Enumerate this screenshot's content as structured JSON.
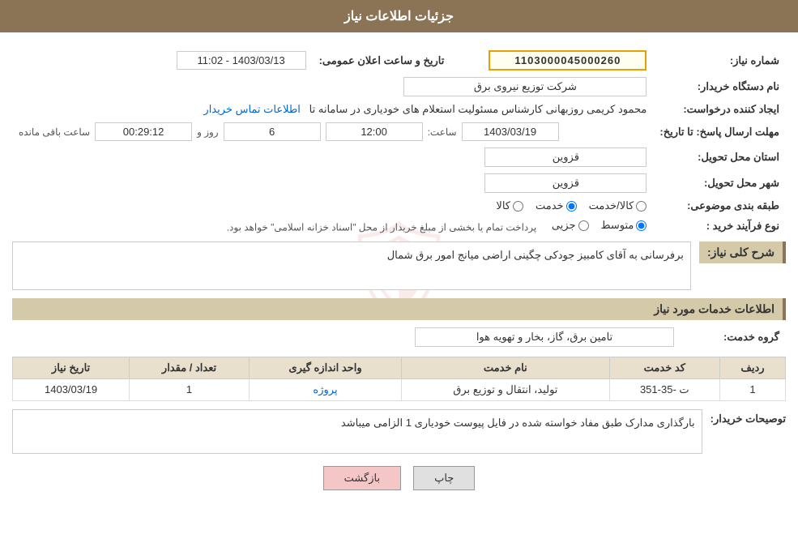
{
  "header": {
    "title": "جزئیات اطلاعات نیاز"
  },
  "form": {
    "need_number_label": "شماره نیاز:",
    "need_number_value": "1103000045000260",
    "buyer_org_label": "نام دستگاه خریدار:",
    "buyer_org_value": "شرکت توزیع نیروی برق",
    "creator_label": "ایجاد کننده درخواست:",
    "creator_name": "محمود کریمی روزبهانی کارشناس  مسئولیت استعلام های خودیاری در سامانه تا",
    "creator_contact_link": "اطلاعات تماس خریدار",
    "send_deadline_label": "مهلت ارسال پاسخ: تا تاریخ:",
    "send_date_value": "1403/03/19",
    "send_time_label": "ساعت:",
    "send_time_value": "12:00",
    "send_days_label": "روز و",
    "send_days_value": "6",
    "send_remaining_label": "ساعت باقی مانده",
    "send_remaining_value": "00:29:12",
    "announce_label": "تاریخ و ساعت اعلان عمومی:",
    "announce_value": "1403/03/13 - 11:02",
    "province_label": "استان محل تحویل:",
    "province_value": "قزوین",
    "city_label": "شهر محل تحویل:",
    "city_value": "قزوین",
    "category_label": "طبقه بندی موضوعی:",
    "category_options": [
      {
        "label": "کالا",
        "value": "kala"
      },
      {
        "label": "خدمت",
        "value": "khedmat"
      },
      {
        "label": "کالا/خدمت",
        "value": "kala_khedmat"
      }
    ],
    "category_selected": "khedmat",
    "purchase_type_label": "نوع فرآیند خرید :",
    "purchase_type_options": [
      {
        "label": "جزیی",
        "value": "jozi"
      },
      {
        "label": "متوسط",
        "value": "mottavaset"
      }
    ],
    "purchase_type_selected": "mottavaset",
    "purchase_type_note": "پرداخت تمام یا بخشی از مبلغ خریدار از محل \"اسناد خزانه اسلامی\" خواهد بود.",
    "need_desc_label": "شرح کلی نیاز:",
    "need_desc_value": "برفرسانی به آقای کامبیز جودکی چگینی اراضی میانج امور برق شمال",
    "services_title": "اطلاعات خدمات مورد نیاز",
    "service_group_label": "گروه خدمت:",
    "service_group_value": "تامین برق، گاز، بخار و تهویه هوا",
    "table": {
      "headers": [
        "ردیف",
        "کد خدمت",
        "نام خدمت",
        "واحد اندازه گیری",
        "تعداد / مقدار",
        "تاریخ نیاز"
      ],
      "rows": [
        {
          "row_num": "1",
          "service_code": "ت -35-351",
          "service_name": "تولید، انتقال و توزیع برق",
          "unit": "پروژه",
          "quantity": "1",
          "need_date": "1403/03/19"
        }
      ]
    },
    "buyer_desc_label": "توصیحات خریدار:",
    "buyer_desc_value": "بارگذاری مدارک طبق مفاد خواسته شده در فایل پیوست خودیاری 1 الزامی میباشد",
    "btn_print": "چاپ",
    "btn_back": "بازگشت"
  }
}
